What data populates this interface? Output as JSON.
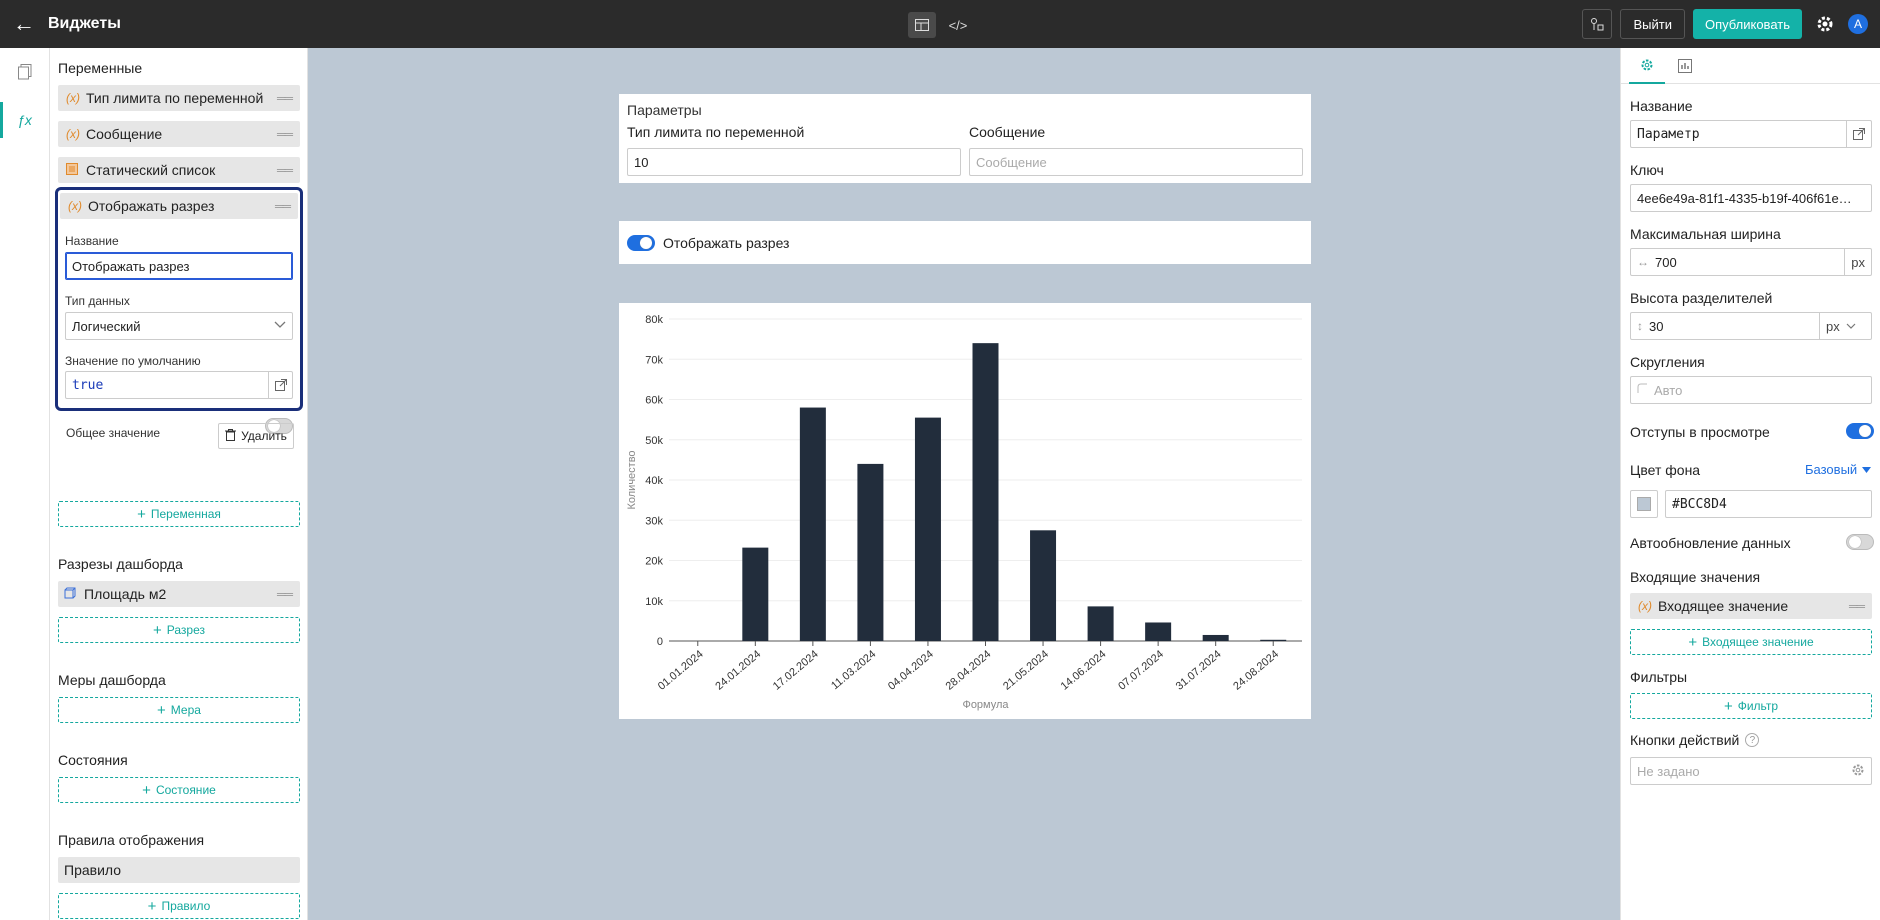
{
  "header": {
    "title": "Виджеты",
    "exit_label": "Выйти",
    "publish_label": "Опубликовать",
    "avatar_letter": "A",
    "mode_icons": [
      "layout-icon",
      "code-icon"
    ]
  },
  "rail": {
    "items": [
      "pages-icon",
      "fx-icon"
    ]
  },
  "left": {
    "variables_title": "Переменные",
    "variables": [
      {
        "label": "Тип лимита по переменной",
        "icon": "variable-icon"
      },
      {
        "label": "Сообщение",
        "icon": "variable-icon"
      },
      {
        "label": "Статический список",
        "icon": "list-icon"
      },
      {
        "label": "Отображать разрез",
        "icon": "variable-icon"
      }
    ],
    "editor": {
      "name_label": "Название",
      "name_value": "Отображать разрез",
      "type_label": "Тип данных",
      "type_value": "Логический",
      "default_label": "Значение по умолчанию",
      "default_value": "true",
      "shared_label": "Общее значение",
      "delete_label": "Удалить"
    },
    "add_variable": "Переменная",
    "slices_title": "Разрезы дашборда",
    "slice_item": "Площадь м2",
    "add_slice": "Разрез",
    "measures_title": "Меры дашборда",
    "add_measure": "Мера",
    "states_title": "Состояния",
    "add_state": "Состояние",
    "rules_title": "Правила отображения",
    "rule_item": "Правило",
    "add_rule": "Правило"
  },
  "canvas": {
    "params": {
      "title": "Параметры",
      "field1_label": "Тип лимита по переменной",
      "field1_value": "10",
      "field2_label": "Сообщение",
      "field2_placeholder": "Сообщение"
    },
    "toggle_label": "Отображать разрез"
  },
  "chart_data": {
    "type": "bar",
    "categories": [
      "01.01.2024",
      "24.01.2024",
      "17.02.2024",
      "11.03.2024",
      "04.04.2024",
      "28.04.2024",
      "21.05.2024",
      "14.06.2024",
      "07.07.2024",
      "31.07.2024",
      "24.08.2024"
    ],
    "values": [
      0,
      23200,
      58000,
      44000,
      55500,
      74000,
      27500,
      8600,
      4600,
      1500,
      300
    ],
    "xlabel": "Формула",
    "ylabel": "Количество",
    "ylim": [
      0,
      80000
    ],
    "yticks": [
      "0",
      "10k",
      "20k",
      "30k",
      "40k",
      "50k",
      "60k",
      "70k",
      "80k"
    ],
    "bar_color": "#222d3c",
    "grid": true
  },
  "right": {
    "name_label": "Название",
    "name_value": "Параметр",
    "key_label": "Ключ",
    "key_value": "4ee6e49a-81f1-4335-b19f-406f61e…",
    "maxwidth_label": "Максимальная ширина",
    "maxwidth_value": "700",
    "maxwidth_unit": "px",
    "divider_label": "Высота разделителей",
    "divider_value": "30",
    "divider_unit": "px",
    "rounding_label": "Скругления",
    "rounding_placeholder": "Авто",
    "padding_label": "Отступы в просмотре",
    "bg_label": "Цвет фона",
    "bg_mode": "Базовый",
    "bg_value": "#BCC8D4",
    "autorefresh_label": "Автообновление данных",
    "incoming_label": "Входящие значения",
    "incoming_item": "Входящее значение",
    "add_incoming": "Входящее значение",
    "filters_label": "Фильтры",
    "add_filter": "Фильтр",
    "actions_label": "Кнопки действий",
    "actions_placeholder": "Не задано"
  }
}
